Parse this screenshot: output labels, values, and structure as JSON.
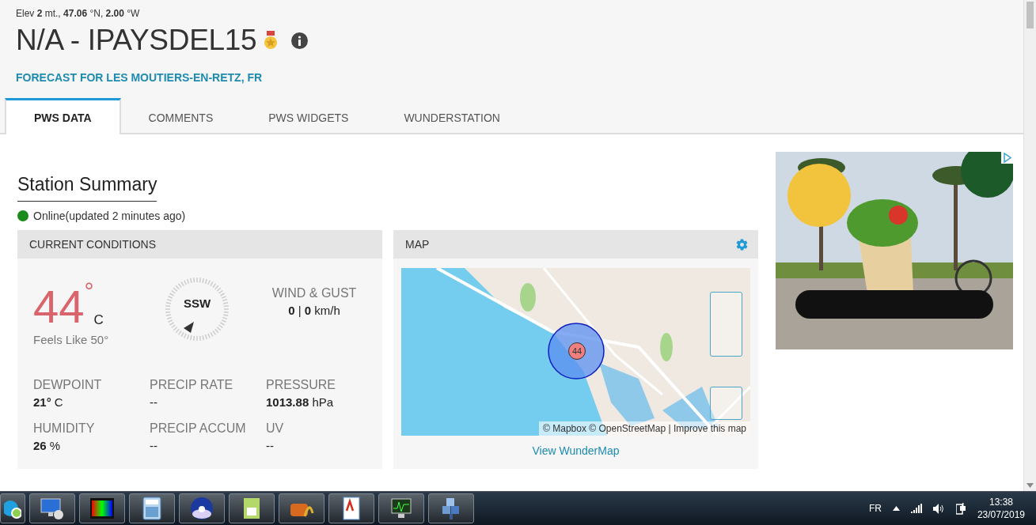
{
  "station": {
    "location_line": "Elev **2** mt., **47.06** °N, **2.00** °W",
    "title": "N/A - IPAYSDEL15",
    "forecast_link": "FORECAST FOR LES MOUTIERS-EN-RETZ, FR"
  },
  "tabs": [
    {
      "label": "PWS DATA",
      "selected": true
    },
    {
      "label": "COMMENTS",
      "selected": false
    },
    {
      "label": "PWS WIDGETS",
      "selected": false
    },
    {
      "label": "WUNDERSTATION",
      "selected": false
    }
  ],
  "summary": {
    "heading": "Station Summary",
    "status": {
      "online": true,
      "text": "Online(updated 2 minutes ago)"
    }
  },
  "current_conditions": {
    "header": "CURRENT CONDITIONS",
    "temperature": "44",
    "degree": "°",
    "unit": "C",
    "feels_like": "Feels Like 50°",
    "wind_direction": "SSW",
    "wind_label": "WIND & GUST",
    "wind_value": "**0** | **0** km/h",
    "metrics": [
      {
        "label": "DEWPOINT",
        "value": "**21°** C"
      },
      {
        "label": "PRECIP RATE",
        "value": "--"
      },
      {
        "label": "PRESSURE",
        "value": "**1013.88** hPa"
      },
      {
        "label": "HUMIDITY",
        "value": "**26** %"
      },
      {
        "label": "PRECIP ACCUM",
        "value": "--"
      },
      {
        "label": "UV",
        "value": "--"
      }
    ]
  },
  "map": {
    "header": "MAP",
    "marker": "44",
    "attribution": "© Mapbox © OpenStreetMap | Improve this map",
    "link": "View WunderMap"
  },
  "taskbar": {
    "language": "FR",
    "time": "13:38",
    "date": "23/07/2019"
  }
}
